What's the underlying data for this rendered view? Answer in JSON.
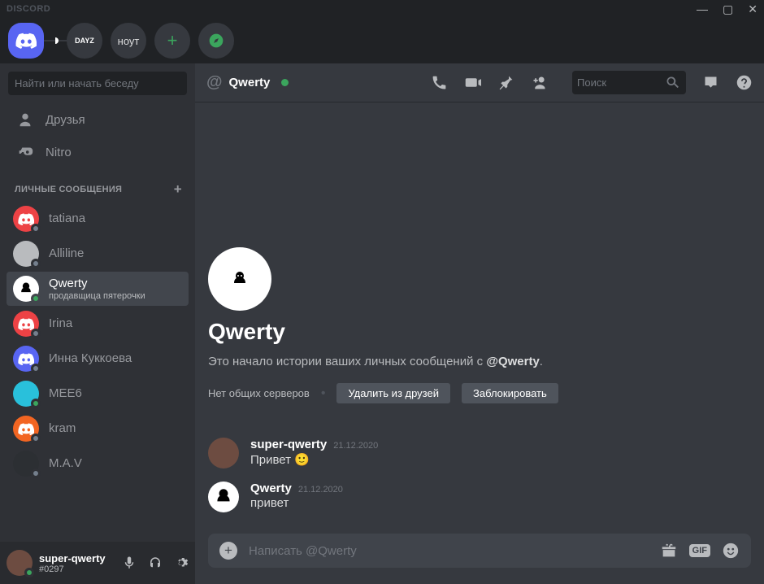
{
  "titlebar": {
    "logo": "DISCORD"
  },
  "servers": {
    "dayz": "DAYZ",
    "text_server": "ноут"
  },
  "sidebar": {
    "search_placeholder": "Найти или начать беседу",
    "friends": "Друзья",
    "nitro": "Nitro",
    "section_label": "ЛИЧНЫЕ СООБЩЕНИЯ",
    "dms": [
      {
        "name": "tatiana",
        "status": "offline",
        "avatar": "red"
      },
      {
        "name": "Alliline",
        "status": "offline",
        "avatar": "grey"
      },
      {
        "name": "Qwerty",
        "sub": "продавщица пятерочки",
        "status": "online",
        "avatar": "white",
        "active": true
      },
      {
        "name": "Irina",
        "status": "offline",
        "avatar": "red"
      },
      {
        "name": "Инна Куккоева",
        "status": "offline",
        "avatar": "blue"
      },
      {
        "name": "MEE6",
        "status": "online",
        "avatar": "cyan"
      },
      {
        "name": "kram",
        "status": "offline",
        "avatar": "orange"
      },
      {
        "name": "M.A.V",
        "status": "offline",
        "avatar": "dark"
      }
    ]
  },
  "user_panel": {
    "name": "super-qwerty",
    "tag": "#0297"
  },
  "chat": {
    "title": "Qwerty",
    "search_placeholder": "Поиск",
    "profile": {
      "name": "Qwerty",
      "desc_prefix": "Это начало истории ваших личных сообщений с ",
      "desc_mention": "@Qwerty",
      "desc_suffix": ".",
      "no_mutual": "Нет общих серверов",
      "remove_friend": "Удалить из друзей",
      "block": "Заблокировать"
    },
    "messages": [
      {
        "author": "super-qwerty",
        "time": "21.12.2020",
        "text": "Привет 🙂",
        "avatar": "brown"
      },
      {
        "author": "Qwerty",
        "time": "21.12.2020",
        "text": "привет",
        "avatar": "white"
      }
    ],
    "input_placeholder": "Написать @Qwerty",
    "gif_label": "GIF"
  }
}
